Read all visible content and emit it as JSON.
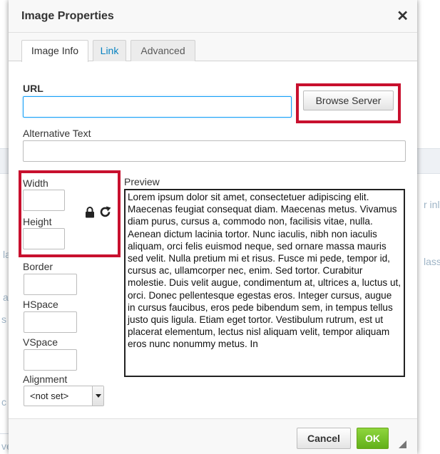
{
  "background": {
    "fragment_right_top": "r inl",
    "fragment_right_mid": "lass",
    "fragment_left_la": "la",
    "fragment_left_a": "a",
    "fragment_left_s": "s",
    "fragment_left_c": "c",
    "fragment_left_ve": "ve"
  },
  "dialog": {
    "title": "Image Properties",
    "close_glyph": "✕"
  },
  "tabs": [
    {
      "label": "Image Info",
      "active": true
    },
    {
      "label": "Link",
      "active": false
    },
    {
      "label": "Advanced",
      "active": false
    }
  ],
  "form": {
    "url_label": "URL",
    "url_value": "",
    "browse_label": "Browse Server",
    "alt_label": "Alternative Text",
    "alt_value": "",
    "width_label": "Width",
    "width_value": "",
    "height_label": "Height",
    "height_value": "",
    "lock_icon": "lock-icon",
    "reset_icon": "reset-size-icon",
    "border_label": "Border",
    "border_value": "",
    "hspace_label": "HSpace",
    "hspace_value": "",
    "vspace_label": "VSpace",
    "vspace_value": "",
    "alignment_label": "Alignment",
    "alignment_value": "<not set>"
  },
  "preview": {
    "label": "Preview",
    "text": "Lorem ipsum dolor sit amet, consectetuer adipiscing elit. Maecenas feugiat consequat diam. Maecenas metus. Vivamus diam purus, cursus a, commodo non, facilisis vitae, nulla. Aenean dictum lacinia tortor. Nunc iaculis, nibh non iaculis aliquam, orci felis euismod neque, sed ornare massa mauris sed velit. Nulla pretium mi et risus. Fusce mi pede, tempor id, cursus ac, ullamcorper nec, enim. Sed tortor. Curabitur molestie. Duis velit augue, condimentum at, ultrices a, luctus ut, orci. Donec pellentesque egestas eros. Integer cursus, augue in cursus faucibus, eros pede bibendum sem, in tempus tellus justo quis ligula. Etiam eget tortor. Vestibulum rutrum, est ut placerat elementum, lectus nisl aliquam velit, tempor aliquam eros nunc nonummy metus. In"
  },
  "footer": {
    "cancel_label": "Cancel",
    "ok_label": "OK"
  },
  "colors": {
    "highlight_border": "#c8102e",
    "ok_green": "#62b01a",
    "link_blue": "#0782c1",
    "focus_blue": "#139ff7"
  }
}
